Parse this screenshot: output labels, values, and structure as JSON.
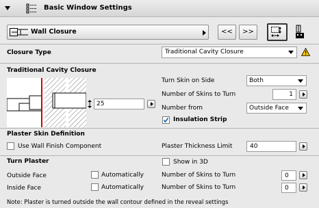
{
  "header": {
    "title": "Basic Window Settings"
  },
  "selector": {
    "label": "Wall Closure",
    "prev_label": "<<",
    "next_label": ">>"
  },
  "closure_type": {
    "label": "Closure Type",
    "value": "Traditional Cavity Closure"
  },
  "tcc": {
    "title": "Traditional Cavity Closure",
    "depth_value": "25",
    "turn_skin_on_side_label": "Turn Skin on Side",
    "turn_skin_on_side_value": "Both",
    "num_skins_label": "Number of Skins to Turn",
    "num_skins_value": "1",
    "number_from_label": "Number from",
    "number_from_value": "Outside Face",
    "insulation_label": "Insulation Strip",
    "insulation_checked": true
  },
  "plaster_skin": {
    "title": "Plaster Skin Definition",
    "use_wall_finish_label": "Use Wall Finish Component",
    "thickness_label": "Plaster Thickness Limit",
    "thickness_value": "40"
  },
  "turn_plaster": {
    "title": "Turn Plaster",
    "show_3d_label": "Show in 3D",
    "outside_face_label": "Outside Face",
    "inside_face_label": "Inside Face",
    "automatically_label": "Automatically",
    "num_skins_label": "Number of Skins to Turn",
    "outside_value": "0",
    "inside_value": "0"
  },
  "note": "Note: Plaster is turned outside the wall contour defined in the reveal settings",
  "colors": {
    "warning": "#f5c400",
    "red_line": "#d20000",
    "hatch": "#777777"
  }
}
